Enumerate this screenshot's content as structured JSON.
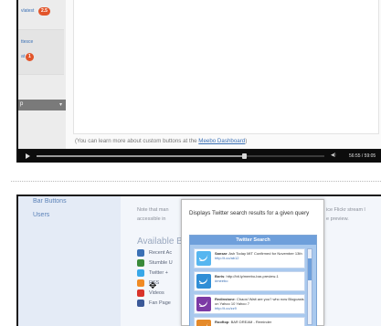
{
  "video": {
    "sidebar": {
      "item1": "vlatest",
      "item1_badge": "2.5",
      "item2": "ttesce",
      "item3": "at",
      "item3_badge": "1",
      "bar_label": "p"
    },
    "note_prefix": "(You can learn more about custom buttons at the ",
    "note_link": "Meebo Dashboard",
    "note_suffix": ")",
    "time": "56:55 / 59:05",
    "progress": 0.72
  },
  "screen": {
    "sidebar": {
      "item1": "Bar Buttons",
      "item2": "Users"
    },
    "note_left_line1": "Note that man",
    "note_left_line2": "accessible in",
    "note_right_line1": "ice Flickr stream l",
    "note_right_line2": "e preview.",
    "available_label": "Available B",
    "buttons": [
      {
        "label": "Recent Ac",
        "icon": "recent-activity-icon",
        "color": "#3b70b5"
      },
      {
        "label": "Stumble U",
        "icon": "stumbleupon-icon",
        "color": "#3a8a3a"
      },
      {
        "label": "Twitter +",
        "icon": "twitter-icon",
        "color": "#38a7e8"
      },
      {
        "label": "RSS",
        "icon": "rss-icon",
        "color": "#f08a24"
      },
      {
        "label": "Videos",
        "icon": "videos-icon",
        "color": "#d9342b"
      },
      {
        "label": "Fan Page",
        "icon": "facebook-icon",
        "color": "#3b5998"
      }
    ],
    "popup": {
      "description": "Displays Twitter search results for a given query",
      "widget_title": "Twitter Search",
      "tweets": [
        {
          "user": "Sansar",
          "text": "Ash Today MIT Confirmed for November 13th",
          "link": "http://t.co/ab12",
          "color": "#56b6f0"
        },
        {
          "user": "Boris",
          "text": "http://bit.ly/meebo-bar-preview-1",
          "link": "#meebo",
          "color": "#2f8ed6"
        },
        {
          "user": "Redinstone",
          "text": "Chaos! Wait are you? who now Blogcasts on Yahoo 10 Yahoo 7",
          "link": "http://t.co/zz9",
          "color": "#7c3aa5"
        },
        {
          "user": "Rooftop",
          "text": "BAR DREAM - Reminder",
          "link": "",
          "color": "#e58a2a"
        }
      ]
    }
  }
}
